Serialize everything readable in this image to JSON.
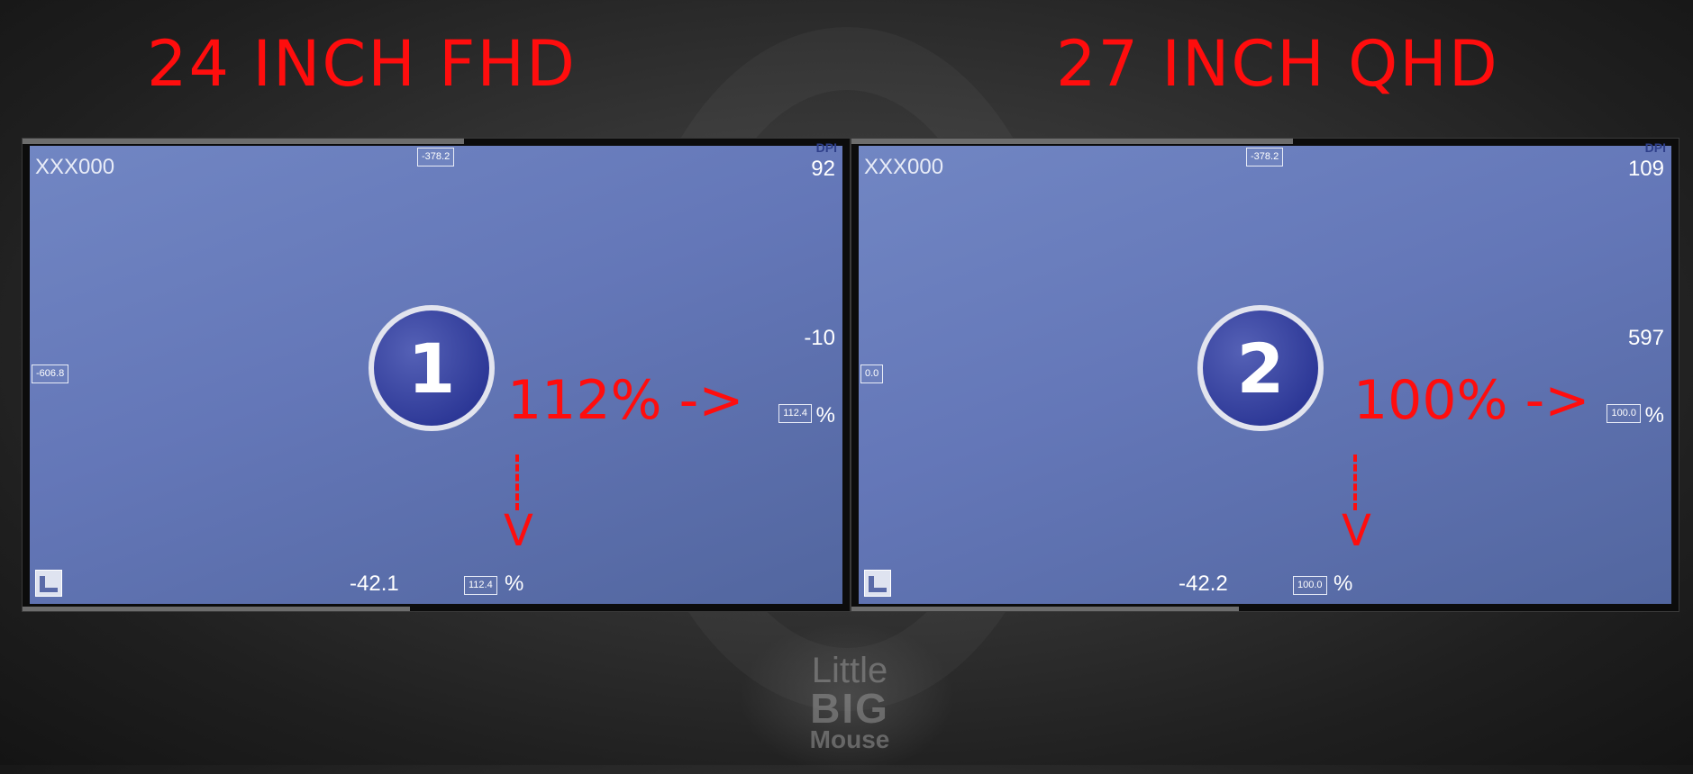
{
  "headings": {
    "left": "24 INCH FHD",
    "right": "27 INCH QHD"
  },
  "monitors": [
    {
      "name": "XXX000",
      "dpi_label": "DPI",
      "dpi": "92",
      "top_offset": "-378.2",
      "left_offset": "-606.8",
      "right_offset": "-10",
      "scale_x": "112.4",
      "scale_y": "112.4",
      "bottom_offset": "-42.1",
      "percent_sign": "%",
      "number": "1",
      "annotation": "112% ->",
      "annotation_down": "V"
    },
    {
      "name": "XXX000",
      "dpi_label": "DPI",
      "dpi": "109",
      "top_offset": "-378.2",
      "left_offset": "0.0",
      "right_offset": "597",
      "scale_x": "100.0",
      "scale_y": "100.0",
      "bottom_offset": "-42.2",
      "percent_sign": "%",
      "number": "2",
      "annotation": "100% ->",
      "annotation_down": "V"
    }
  ],
  "logo": {
    "line1": "Little",
    "line2": "BIG",
    "line3": "Mouse"
  },
  "colors": {
    "annotation": "#ff0d0d",
    "screen": "#6477b8",
    "badge": "#2c3796"
  },
  "icons": {
    "ruler": "ruler-icon"
  }
}
